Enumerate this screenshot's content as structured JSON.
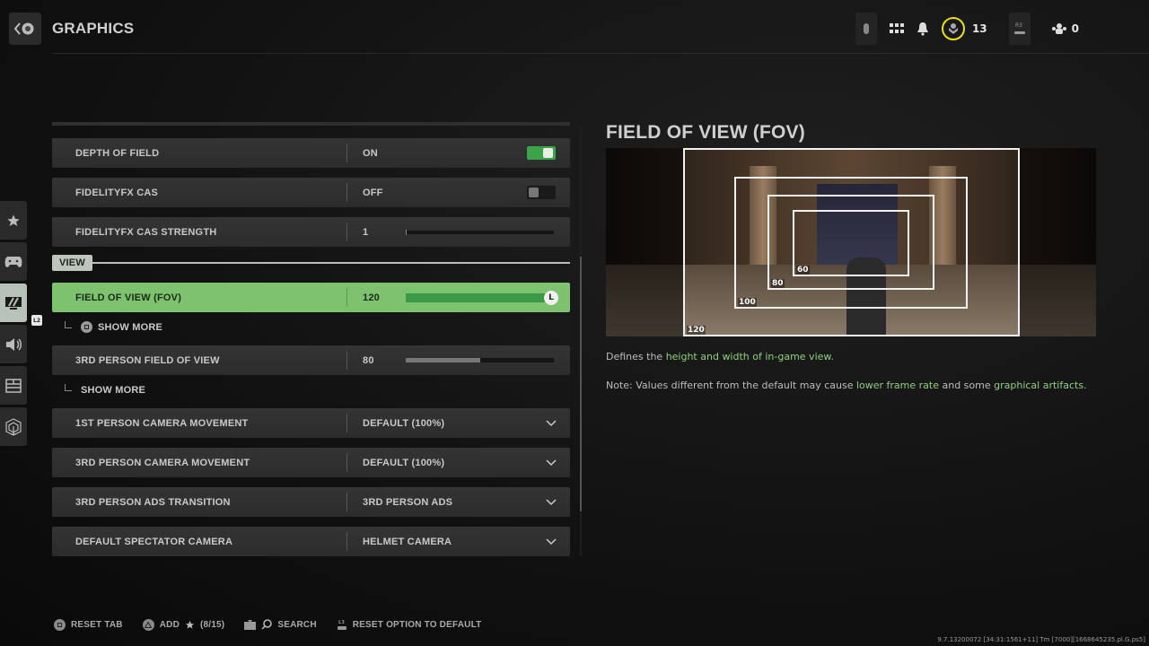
{
  "header": {
    "title": "GRAPHICS",
    "rank_count": "13",
    "party_count": "0",
    "r3_hint": "R3"
  },
  "sidebar": {
    "tabs": [
      {
        "name": "favorites",
        "icon": "star-icon"
      },
      {
        "name": "controller",
        "icon": "controller-icon"
      },
      {
        "name": "graphics",
        "icon": "monitor-icon",
        "active": true
      },
      {
        "name": "audio",
        "icon": "speaker-icon"
      },
      {
        "name": "interface",
        "icon": "layout-icon"
      },
      {
        "name": "account-network",
        "icon": "network-icon"
      }
    ],
    "l2_hint": "L2"
  },
  "settings": {
    "depth_of_field": {
      "label": "DEPTH OF FIELD",
      "value": "ON",
      "toggle": true
    },
    "fidelityfx_cas": {
      "label": "FIDELITYFX CAS",
      "value": "OFF",
      "toggle": false
    },
    "fidelityfx_cas_strength": {
      "label": "FIDELITYFX CAS STRENGTH",
      "value": "1",
      "slider_fraction": 0.0
    },
    "section_view": "VIEW",
    "fov": {
      "label": "FIELD OF VIEW (FOV)",
      "value": "120",
      "slider_fraction": 1.0,
      "knob_label": "L"
    },
    "fov_show_more": "SHOW MORE",
    "third_fov": {
      "label": "3RD PERSON FIELD OF VIEW",
      "value": "80",
      "slider_fraction": 0.5
    },
    "third_fov_show_more": "SHOW MORE",
    "first_cam_move": {
      "label": "1ST PERSON CAMERA MOVEMENT",
      "value": "DEFAULT (100%)"
    },
    "third_cam_move": {
      "label": "3RD PERSON CAMERA MOVEMENT",
      "value": "DEFAULT (100%)"
    },
    "third_ads": {
      "label": "3RD PERSON ADS TRANSITION",
      "value": "3RD PERSON ADS"
    },
    "spectator_cam": {
      "label": "DEFAULT SPECTATOR CAMERA",
      "value": "HELMET CAMERA"
    }
  },
  "detail": {
    "title": "FIELD OF VIEW (FOV)",
    "fov_labels": [
      "120",
      "100",
      "80",
      "60"
    ],
    "desc1_pre": "Defines the ",
    "desc1_hl": "height and width of in-game view.",
    "desc2_pre": "Note: Values different from the default may cause ",
    "desc2_hl1": "lower frame rate",
    "desc2_mid": " and some ",
    "desc2_hl2": "graphical artifacts."
  },
  "footer": {
    "reset_tab": "RESET TAB",
    "add_fav": "ADD",
    "add_fav_count": "(8/15)",
    "search": "SEARCH",
    "reset_option": "RESET OPTION TO DEFAULT"
  },
  "version": "9.7.13200072 [34:31:1561+11] Tm [7000][1668645235.pl.G.ps5]",
  "colors": {
    "accent_green": "#7dc26f",
    "highlight_text": "#8fd07f",
    "rank_ring": "#e6e020"
  }
}
